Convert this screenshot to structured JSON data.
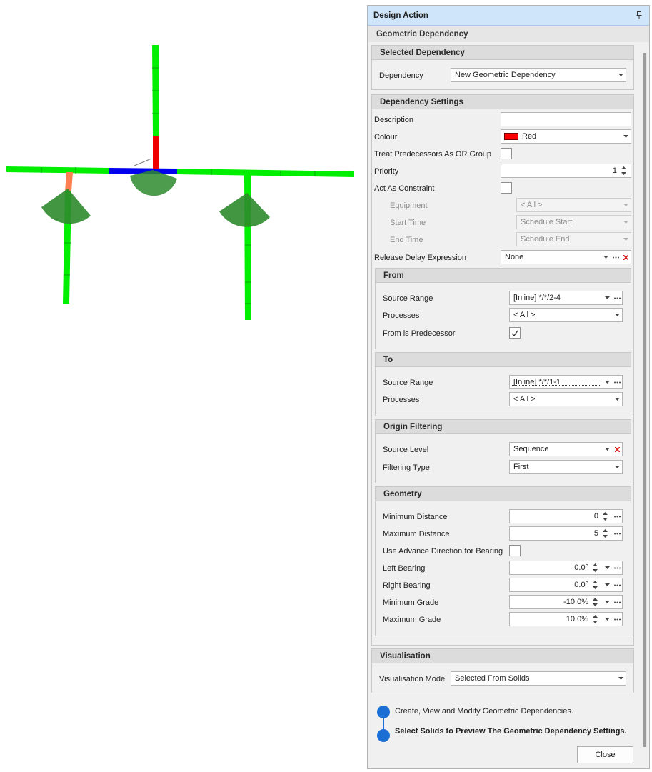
{
  "panel": {
    "title": "Design Action",
    "pin_icon": "pin-icon",
    "subheader": "Geometric Dependency"
  },
  "selected_dependency": {
    "header": "Selected Dependency",
    "dependency_label": "Dependency",
    "dependency_value": "New Geometric Dependency"
  },
  "settings": {
    "header": "Dependency Settings",
    "description_label": "Description",
    "description_value": "",
    "colour_label": "Colour",
    "colour_value": "Red",
    "colour_hex": "#ff0000",
    "treat_pred_label": "Treat Predecessors As OR Group",
    "treat_pred_checked": false,
    "priority_label": "Priority",
    "priority_value": "1",
    "constraint_label": "Act As Constraint",
    "constraint_checked": false,
    "equipment_label": "Equipment",
    "equipment_value": "< All >",
    "start_time_label": "Start Time",
    "start_time_value": "Schedule Start",
    "end_time_label": "End Time",
    "end_time_value": "Schedule End",
    "release_label": "Release Delay Expression",
    "release_value": "None"
  },
  "from": {
    "header": "From",
    "source_range_label": "Source Range",
    "source_range_value": "[Inline] */*/2-4",
    "processes_label": "Processes",
    "processes_value": "< All >",
    "is_pred_label": "From is Predecessor",
    "is_pred_checked": true
  },
  "to": {
    "header": "To",
    "source_range_label": "Source Range",
    "source_range_value": "[Inline] */*/1-1",
    "processes_label": "Processes",
    "processes_value": "< All >"
  },
  "origin_filtering": {
    "header": "Origin Filtering",
    "source_level_label": "Source Level",
    "source_level_value": "Sequence",
    "filtering_type_label": "Filtering Type",
    "filtering_type_value": "First"
  },
  "geometry": {
    "header": "Geometry",
    "min_distance_label": "Minimum Distance",
    "min_distance_value": "0",
    "max_distance_label": "Maximum Distance",
    "max_distance_value": "5",
    "advance_label": "Use Advance Direction for Bearing",
    "advance_checked": false,
    "left_bearing_label": "Left Bearing",
    "left_bearing_value": "0.0°",
    "right_bearing_label": "Right Bearing",
    "right_bearing_value": "0.0°",
    "min_grade_label": "Minimum Grade",
    "min_grade_value": "-10.0%",
    "max_grade_label": "Maximum Grade",
    "max_grade_value": "10.0%"
  },
  "visualisation": {
    "header": "Visualisation",
    "mode_label": "Visualisation Mode",
    "mode_value": "Selected From Solids"
  },
  "steps": [
    {
      "text": "Create, View and Modify Geometric Dependencies.",
      "bold": false
    },
    {
      "text": "Select Solids to Preview The Geometric Dependency Settings.",
      "bold": true
    }
  ],
  "close_label": "Close",
  "viewport_colors": {
    "segment": "#00ee00",
    "selected": "#0000ee",
    "highlight": "#ee0000",
    "orange": "#ff7f50",
    "wedge": "#2e8b2e"
  }
}
